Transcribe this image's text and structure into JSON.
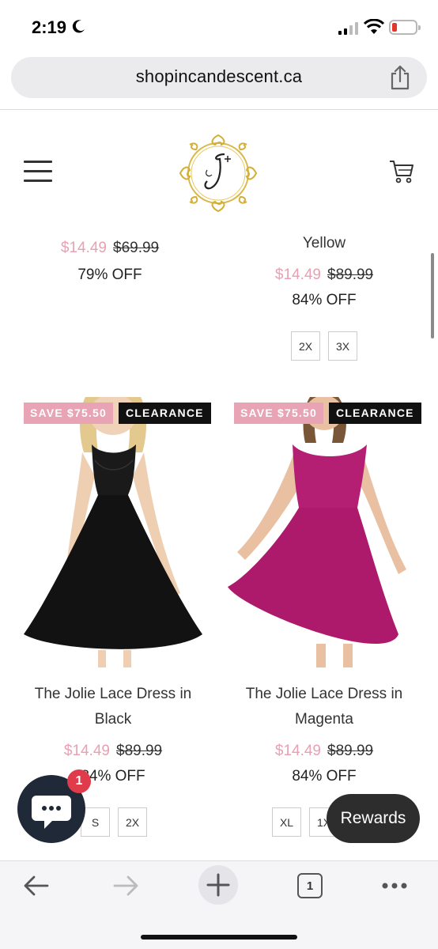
{
  "status": {
    "time": "2:19"
  },
  "browser": {
    "url": "shopincandescent.ca",
    "tab_count": "1"
  },
  "colors": {
    "sale_price": "#e9a0b2",
    "save_badge": "#e8a3b4",
    "clearance_badge": "#111111",
    "chat_bubble": "#1f2937",
    "notification": "#e03b4a"
  },
  "top_products": [
    {
      "name_tail": "",
      "sale_price": "$14.49",
      "orig_price": "$69.99",
      "off": "79% OFF"
    },
    {
      "name_tail": "Yellow",
      "sale_price": "$14.49",
      "orig_price": "$89.99",
      "off": "84% OFF",
      "sizes": [
        "2X",
        "3X"
      ]
    }
  ],
  "products": [
    {
      "save": "SAVE $75.50",
      "clearance": "CLEARANCE",
      "name_line1": "The Jolie Lace Dress in",
      "name_line2": "Black",
      "sale_price": "$14.49",
      "orig_price": "$89.99",
      "off": "84% OFF",
      "sizes": [
        "S",
        "2X"
      ]
    },
    {
      "save": "SAVE $75.50",
      "clearance": "CLEARANCE",
      "name_line1": "The Jolie Lace Dress in",
      "name_line2": "Magenta",
      "sale_price": "$14.49",
      "orig_price": "$89.99",
      "off": "84% OFF",
      "sizes": [
        "XL",
        "1X"
      ]
    }
  ],
  "chat": {
    "badge_count": "1"
  },
  "rewards": {
    "label": "Rewards"
  },
  "icons": [
    "moon-icon",
    "signal-icon",
    "wifi-icon",
    "battery-icon",
    "share-icon",
    "hamburger-menu-icon",
    "logo",
    "cart-icon",
    "chat-icon",
    "back-arrow-icon",
    "forward-arrow-icon",
    "new-tab-icon",
    "tabs-icon",
    "more-icon"
  ]
}
